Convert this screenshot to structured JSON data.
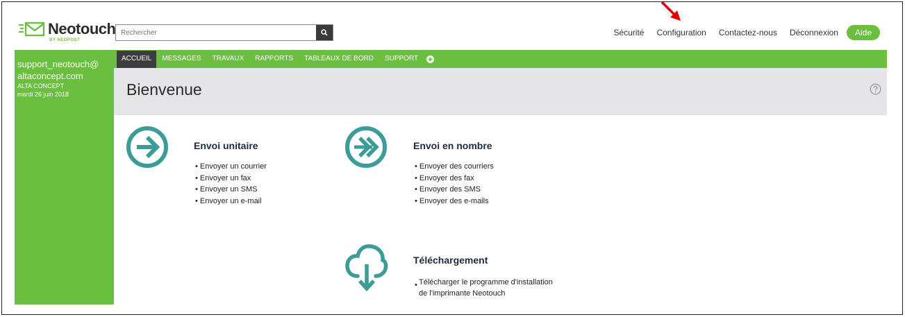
{
  "brand": {
    "name": "Neotouch",
    "sub": "BY NEOPOST"
  },
  "search": {
    "placeholder": "Rechercher"
  },
  "topnav": {
    "items": [
      "Sécurité",
      "Configuration",
      "Contactez-nous",
      "Déconnexion"
    ],
    "help": "Aide"
  },
  "sidebar": {
    "user_line1": "support_neotouch@",
    "user_line2": "altaconcept.com",
    "company": "ALTA CONCEPT",
    "date": "mardi 26 juin 2018"
  },
  "mainnav": {
    "tabs": [
      "ACCUEIL",
      "MESSAGES",
      "TRAVAUX",
      "RAPPORTS",
      "TABLEAUX DE BORD",
      "SUPPORT"
    ]
  },
  "page": {
    "title": "Bienvenue"
  },
  "single": {
    "title": "Envoi unitaire",
    "items": [
      "Envoyer un courrier",
      "Envoyer un fax",
      "Envoyer un SMS",
      "Envoyer un e-mail"
    ]
  },
  "bulk": {
    "title": "Envoi en nombre",
    "items": [
      "Envoyer des courriers",
      "Envoyer des fax",
      "Envoyer des SMS",
      "Envoyer des e-mails"
    ]
  },
  "download": {
    "title": "Téléchargement",
    "line1": "Télécharger le programme d'installation",
    "line2": "de l'imprimante Neotouch"
  },
  "colors": {
    "accent": "#6bbf3e",
    "icon_teal": "#3c9c98",
    "dark": "#3d3d3d",
    "annotation": "#e00000"
  }
}
